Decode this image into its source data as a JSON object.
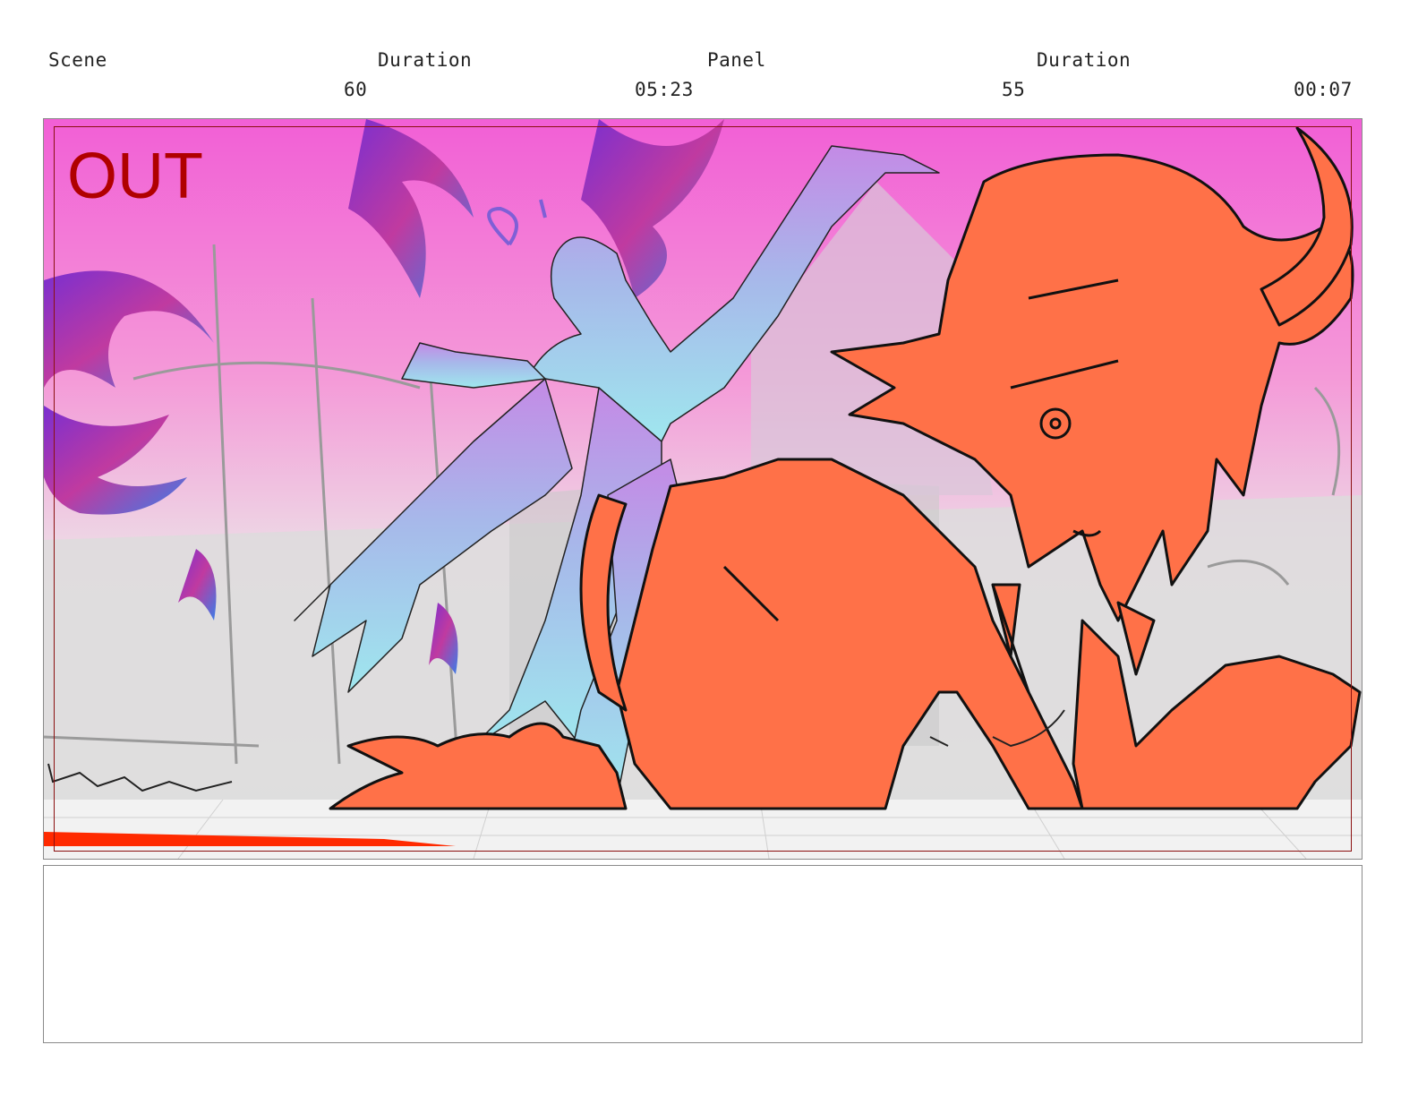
{
  "header": {
    "scene_label": "Scene",
    "scene_duration_label": "Duration",
    "panel_label": "Panel",
    "panel_duration_label": "Duration",
    "scene_number": "60",
    "scene_duration": "05:23",
    "panel_number": "55",
    "panel_duration": "00:07"
  },
  "panel": {
    "transition_label": "OUT",
    "colors": {
      "sky_top": "#f25fd6",
      "sky_bottom": "#eaeaea",
      "hero_fill": "#ff7148",
      "demon_top": "#c48ae6",
      "demon_bottom": "#9fe7ee",
      "claw_dark": "#7a2fd0",
      "accent_red": "#ff2a00"
    }
  },
  "notes": {
    "text": ""
  }
}
